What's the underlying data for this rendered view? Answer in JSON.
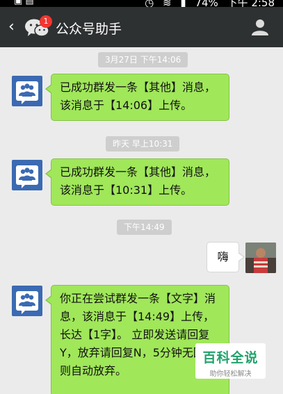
{
  "status_bar": {
    "battery": "74%",
    "time": "下午 2:58"
  },
  "header": {
    "title": "公众号助手",
    "unread_count": "1"
  },
  "messages": [
    {
      "time": "3月27日 下午14:06",
      "text": "已成功群发一条【其他】消息，该消息于【14:06】上传。"
    },
    {
      "time": "昨天 早上10:31",
      "text": "已成功群发一条【其他】消息，该消息于【10:31】上传。"
    },
    {
      "time": "下午14:49",
      "text": "嗨"
    },
    {
      "text": "你正在尝试群发一条【文字】消息，该消息于【14:49】上传，长达【1字】。 立即发送请回复Y，放弃请回复N，5分钟无回复则自动放弃。"
    }
  ],
  "watermark": {
    "title": "百科全说",
    "subtitle": "助你轻松解决"
  },
  "colors": {
    "title_bar": "#2e3132",
    "chat_bg": "#ebebeb",
    "bubble_green": "#a0e75a",
    "badge_red": "#f43530",
    "group_avatar": "#3b6ab3"
  }
}
